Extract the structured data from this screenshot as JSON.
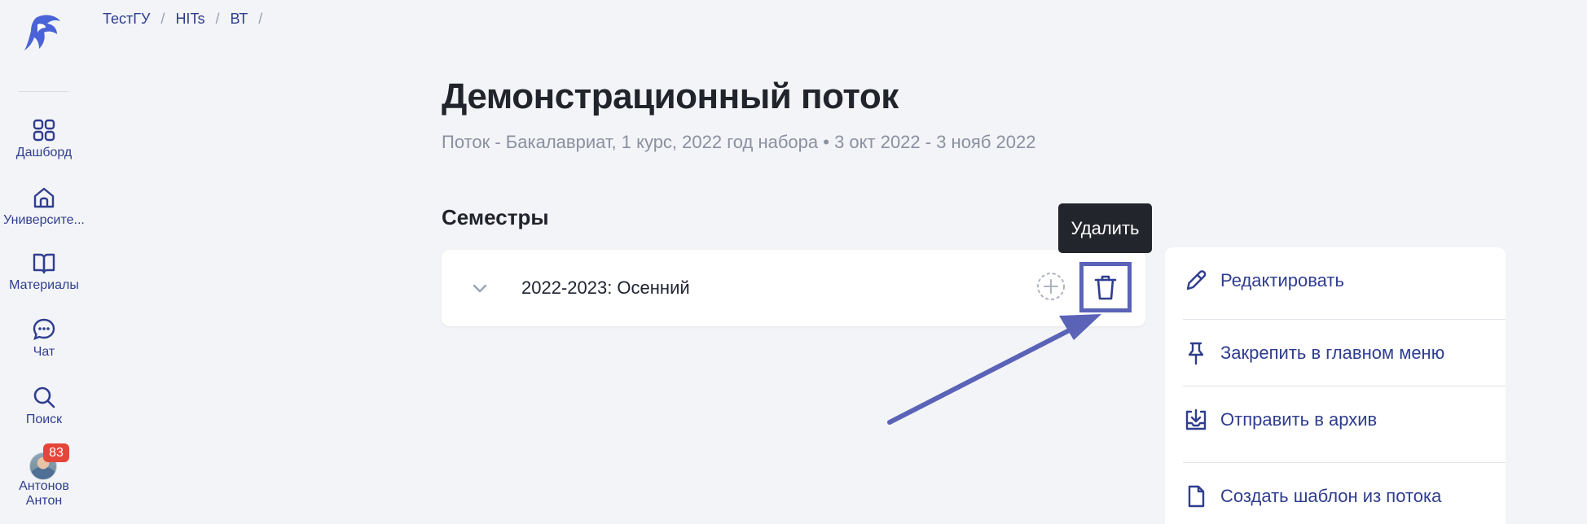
{
  "sidebar": {
    "items": [
      {
        "label": "Дашборд",
        "icon": "grid-icon"
      },
      {
        "label": "Университе...",
        "icon": "university-icon"
      },
      {
        "label": "Материалы",
        "icon": "book-icon"
      },
      {
        "label": "Чат",
        "icon": "chat-icon"
      },
      {
        "label": "Поиск",
        "icon": "search-icon"
      }
    ],
    "user": {
      "badge_count": "83",
      "name_line1": "Антонов",
      "name_line2": "Антон"
    }
  },
  "breadcrumb": [
    "ТестГУ",
    "HITs",
    "ВТ"
  ],
  "breadcrumb_separator": "/",
  "page": {
    "title": "Демонстрационный поток",
    "subtitle": "Поток - Бакалавриат, 1 курс, 2022 год набора • 3 окт 2022 - 3 нояб 2022",
    "section_title": "Семестры"
  },
  "semester": {
    "name": "2022-2023: Осенний"
  },
  "tooltip": "Удалить",
  "actions": [
    {
      "label": "Редактировать",
      "icon": "pencil-icon"
    },
    {
      "label": "Закрепить в главном меню",
      "icon": "pin-icon"
    },
    {
      "label": "Отправить в архив",
      "icon": "archive-icon"
    },
    {
      "label": "Создать шаблон из потока",
      "icon": "file-icon"
    }
  ],
  "colors": {
    "accent": "#2f3d8f",
    "highlight": "#5a63b7",
    "badge": "#e5463a",
    "background": "#f3f4f7"
  }
}
